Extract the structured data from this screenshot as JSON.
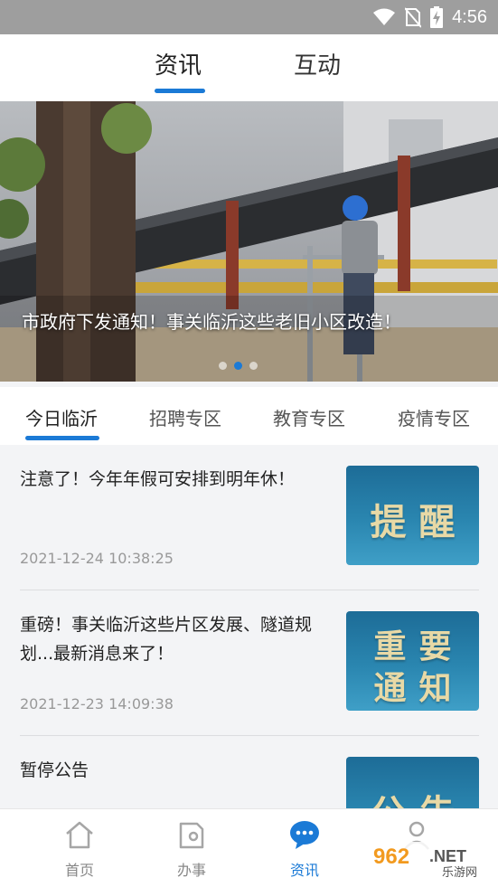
{
  "status_bar": {
    "time": "4:56",
    "icons": [
      "wifi-icon",
      "no-sim-icon",
      "battery-charging-icon"
    ]
  },
  "top_tabs": [
    {
      "label": "资讯",
      "active": true
    },
    {
      "label": "互动",
      "active": false
    }
  ],
  "banner": {
    "caption": "市政府下发通知！事关临沂这些老旧小区改造！",
    "dots": 3,
    "active_dot": 1
  },
  "sub_tabs": [
    {
      "label": "今日临沂",
      "active": true
    },
    {
      "label": "招聘专区",
      "active": false
    },
    {
      "label": "教育专区",
      "active": false
    },
    {
      "label": "疫情专区",
      "active": false
    }
  ],
  "news": [
    {
      "title": "注意了！今年年假可安排到明年休！",
      "time": "2021-12-24 10:38:25",
      "thumb_text": [
        "提醒"
      ]
    },
    {
      "title": "重磅！事关临沂这些片区发展、隧道规划...最新消息来了！",
      "time": "2021-12-23 14:09:38",
      "thumb_text": [
        "重要",
        "通知"
      ]
    },
    {
      "title": "暂停公告",
      "time": "",
      "thumb_text": [
        "公告"
      ]
    }
  ],
  "bottom_nav": [
    {
      "label": "首页",
      "icon": "home-icon",
      "active": false
    },
    {
      "label": "办事",
      "icon": "wallet-icon",
      "active": false
    },
    {
      "label": "资讯",
      "icon": "chat-bubble-icon",
      "active": true
    },
    {
      "label": "",
      "icon": "user-icon",
      "active": false
    }
  ],
  "watermark": {
    "number": "962",
    "suffix": ".NET",
    "site": "乐游网"
  },
  "colors": {
    "accent": "#1b7ad6",
    "status_bar": "#9e9e9e",
    "thumb": "#2a86b0"
  }
}
